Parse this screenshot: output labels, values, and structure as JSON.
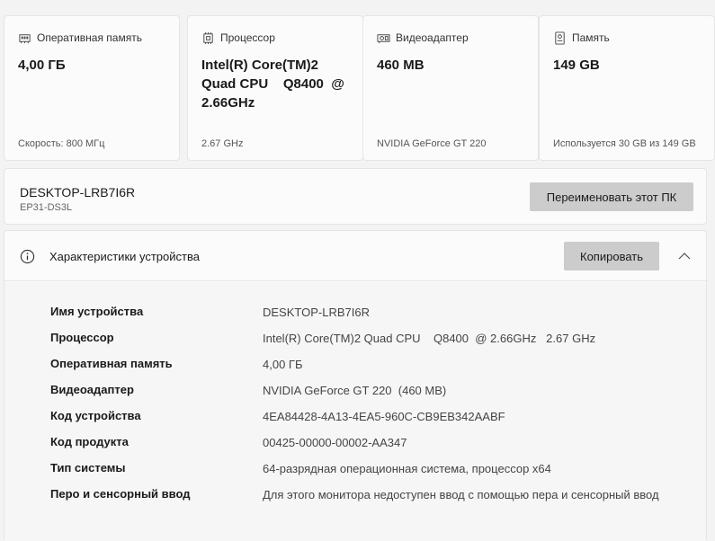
{
  "cards": [
    {
      "icon": "ram-icon",
      "title": "Оперативная память",
      "value": "4,00 ГБ",
      "detail": "Скорость: 800 МГц"
    },
    {
      "icon": "cpu-icon",
      "title": "Процессор",
      "value": "Intel(R) Core(TM)2 Quad CPU    Q8400  @ 2.66GHz",
      "detail": "2.67 GHz"
    },
    {
      "icon": "gpu-icon",
      "title": "Видеоадаптер",
      "value": "460 MB",
      "detail": "NVIDIA GeForce GT 220"
    },
    {
      "icon": "storage-icon",
      "title": "Память",
      "value": "149 GB",
      "detail": "Используется 30 GB из 149 GB"
    }
  ],
  "device": {
    "name": "DESKTOP-LRB7I6R",
    "model": "EP31-DS3L",
    "rename_label": "Переименовать этот ПК"
  },
  "specs": {
    "title": "Характеристики устройства",
    "copy_label": "Копировать",
    "rows": [
      {
        "label": "Имя устройства",
        "value": "DESKTOP-LRB7I6R"
      },
      {
        "label": "Процессор",
        "value": "Intel(R) Core(TM)2 Quad CPU    Q8400  @ 2.66GHz   2.67 GHz"
      },
      {
        "label": "Оперативная память",
        "value": "4,00 ГБ"
      },
      {
        "label": "Видеоадаптер",
        "value": "NVIDIA GeForce GT 220  (460 MB)"
      },
      {
        "label": "Код устройства",
        "value": "4EA84428-4A13-4EA5-960C-CB9EB342AABF"
      },
      {
        "label": "Код продукта",
        "value": "00425-00000-00002-AA347"
      },
      {
        "label": "Тип системы",
        "value": "64-разрядная операционная система, процессор x64"
      },
      {
        "label": "Перо и сенсорный ввод",
        "value": "Для этого монитора недоступен ввод с помощью пера и сенсорный ввод"
      }
    ]
  }
}
